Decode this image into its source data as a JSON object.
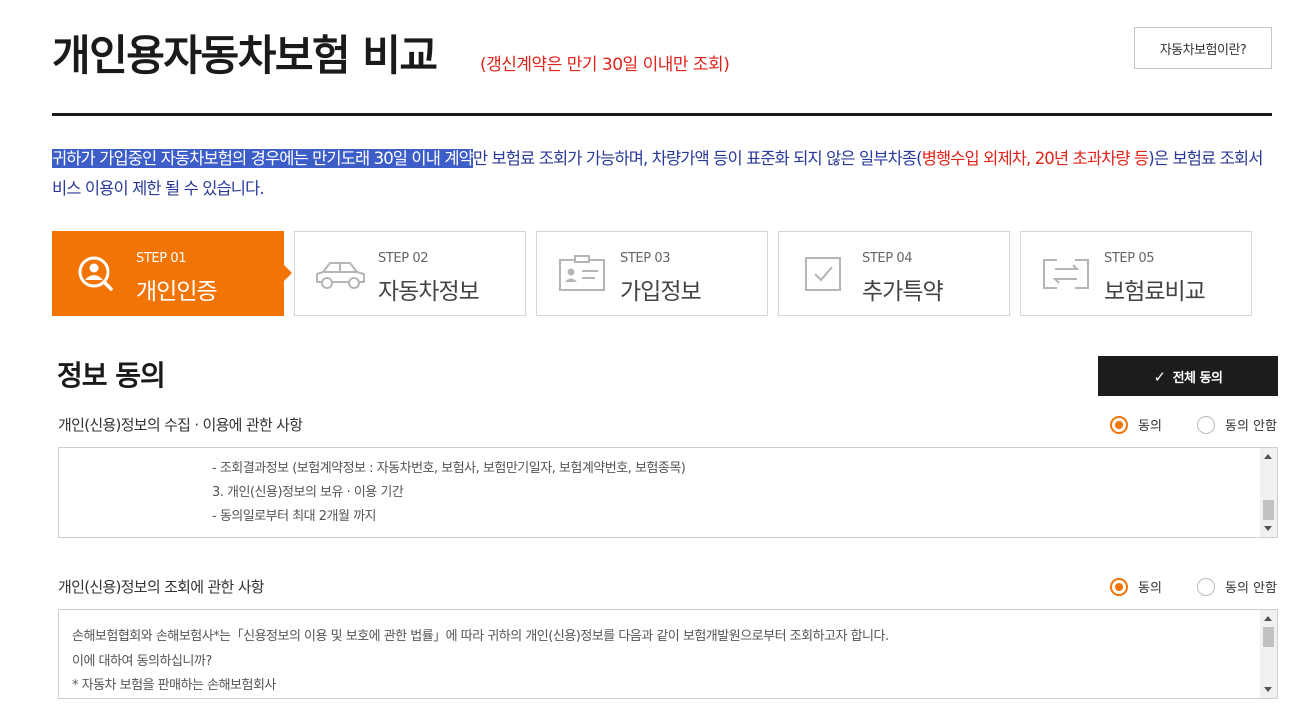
{
  "header": {
    "title": "개인용자동차보험 비교",
    "subtitle": "(갱신계약은 만기 30일 이내만 조회)",
    "info_button": "자동차보험이란?"
  },
  "notice": {
    "highlighted": "귀하가 가입중인 자동차보험의 경우에는 만기도래 30일 이내 계약",
    "text1": "만 보험료 조회가 가능하며, 차량가액 등이 표준화 되지 않은 일부차종(",
    "red": "병행수입 외제차, 20년 초과차량 등",
    "text2": ")은 보험료 조회서비스 이용이 제한 될 수 있습니다."
  },
  "steps": [
    {
      "num": "STEP 01",
      "name": "개인인증",
      "icon": "search-user-icon",
      "active": true
    },
    {
      "num": "STEP 02",
      "name": "자동차정보",
      "icon": "car-icon",
      "active": false
    },
    {
      "num": "STEP 03",
      "name": "가입정보",
      "icon": "id-card-icon",
      "active": false
    },
    {
      "num": "STEP 04",
      "name": "추가특약",
      "icon": "checkbox-icon",
      "active": false
    },
    {
      "num": "STEP 05",
      "name": "보험료비교",
      "icon": "compare-icon",
      "active": false
    }
  ],
  "section": {
    "title": "정보 동의",
    "agree_all": "전체 동의"
  },
  "consents": [
    {
      "label": "개인(신용)정보의 수집 · 이용에 관한 사항",
      "agree": "동의",
      "disagree": "동의 안함",
      "lines": [
        "- 조회결과정보 (보험계약정보 : 자동차번호, 보험사, 보험만기일자, 보험계약번호, 보험종목)",
        "3. 개인(신용)정보의 보유 · 이용 기간",
        "- 동의일로부터 최대 2개월 까지"
      ]
    },
    {
      "label": "개인(신용)정보의 조회에 관한 사항",
      "agree": "동의",
      "disagree": "동의 안함",
      "lines": [
        "손해보험협회와 손해보험사*는「신용정보의 이용 및 보호에 관한 법률」에 따라 귀하의 개인(신용)정보를 다음과 같이 보험개발원으로부터 조회하고자 합니다.",
        "이에 대하여 동의하십니까?",
        "* 자동차 보험을 판매하는 손해보험회사"
      ]
    }
  ],
  "colors": {
    "accent": "#f27405",
    "alert_red": "#e2231a",
    "notice_blue": "#2a3a98",
    "dark": "#1c1c1c"
  }
}
